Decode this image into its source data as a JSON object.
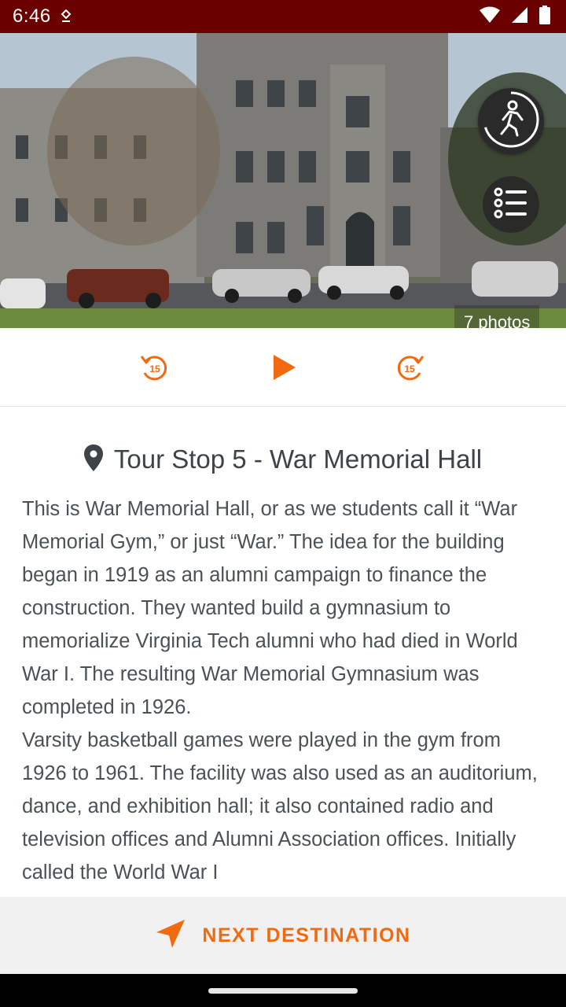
{
  "status_bar": {
    "time": "6:46",
    "icons": [
      "download-status-icon",
      "wifi-icon",
      "signal-icon",
      "battery-icon"
    ]
  },
  "hero": {
    "photos_label": "7 photos",
    "walk_icon": "walking-person-icon",
    "list_icon": "list-icon"
  },
  "player": {
    "rewind_icon": "rewind-15-icon",
    "play_icon": "play-icon",
    "forward_icon": "forward-15-icon",
    "rewind_seconds": "15",
    "forward_seconds": "15"
  },
  "stop": {
    "title": "Tour Stop 5 - War Memorial Hall",
    "paragraph_1": "This is War Memorial Hall, or as we students call it “War Memorial Gym,” or just “War.” The idea for the building began in 1919 as an alumni campaign to finance the construction. They wanted build a gymnasium to memorialize Virginia Tech alumni who had died in World War I. The resulting War Memorial Gymnasium was completed in 1926.",
    "paragraph_2": "Varsity basketball games were played in the gym from 1926 to 1961. The facility was also used as an auditorium, dance, and exhibition hall; it also contained radio and television offices and Alumni Association offices. Initially called the World War I"
  },
  "footer": {
    "next_label": "NEXT DESTINATION",
    "next_icon": "navigation-arrow-icon"
  },
  "colors": {
    "status_bar": "#6b0000",
    "accent": "#f26a0f",
    "text": "#4a5257",
    "title": "#3c4449"
  }
}
